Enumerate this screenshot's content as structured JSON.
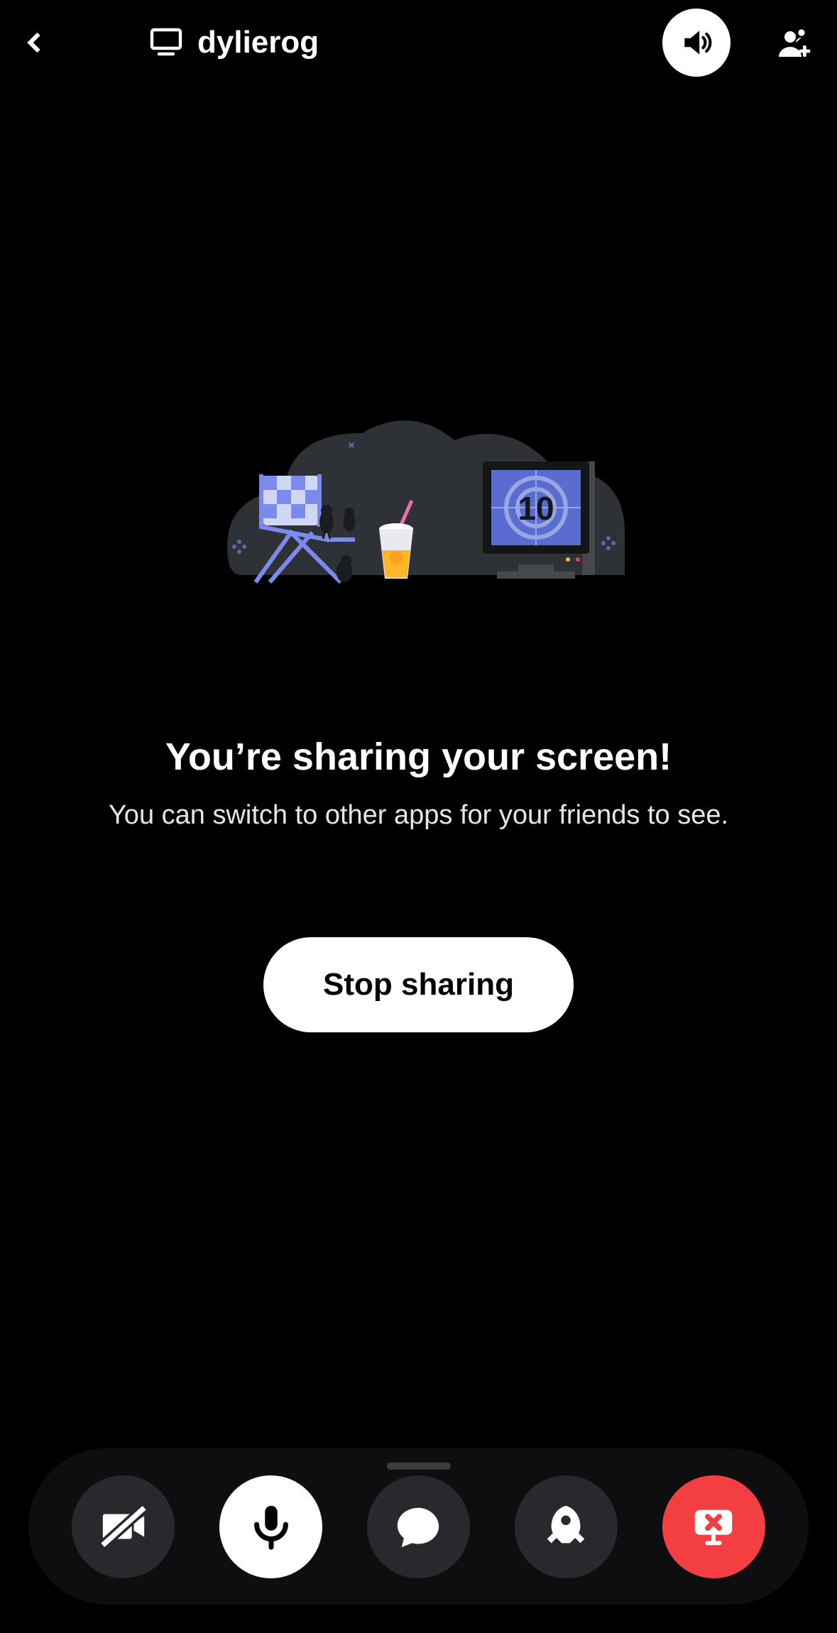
{
  "header": {
    "channel_name": "dylierog"
  },
  "content": {
    "illustration_counter": "10",
    "headline": "You’re sharing your screen!",
    "subline": "You can switch to other apps for your friends to see.",
    "stop_button_label": "Stop sharing"
  },
  "bottom_actions": {
    "camera": "camera-off",
    "mic": "microphone",
    "chat": "chat",
    "activity": "rocket",
    "stop_share": "screen-share-stop"
  },
  "colors": {
    "danger": "#f33f42",
    "surface_dark": "#28292d",
    "bar": "#0e0e10"
  }
}
